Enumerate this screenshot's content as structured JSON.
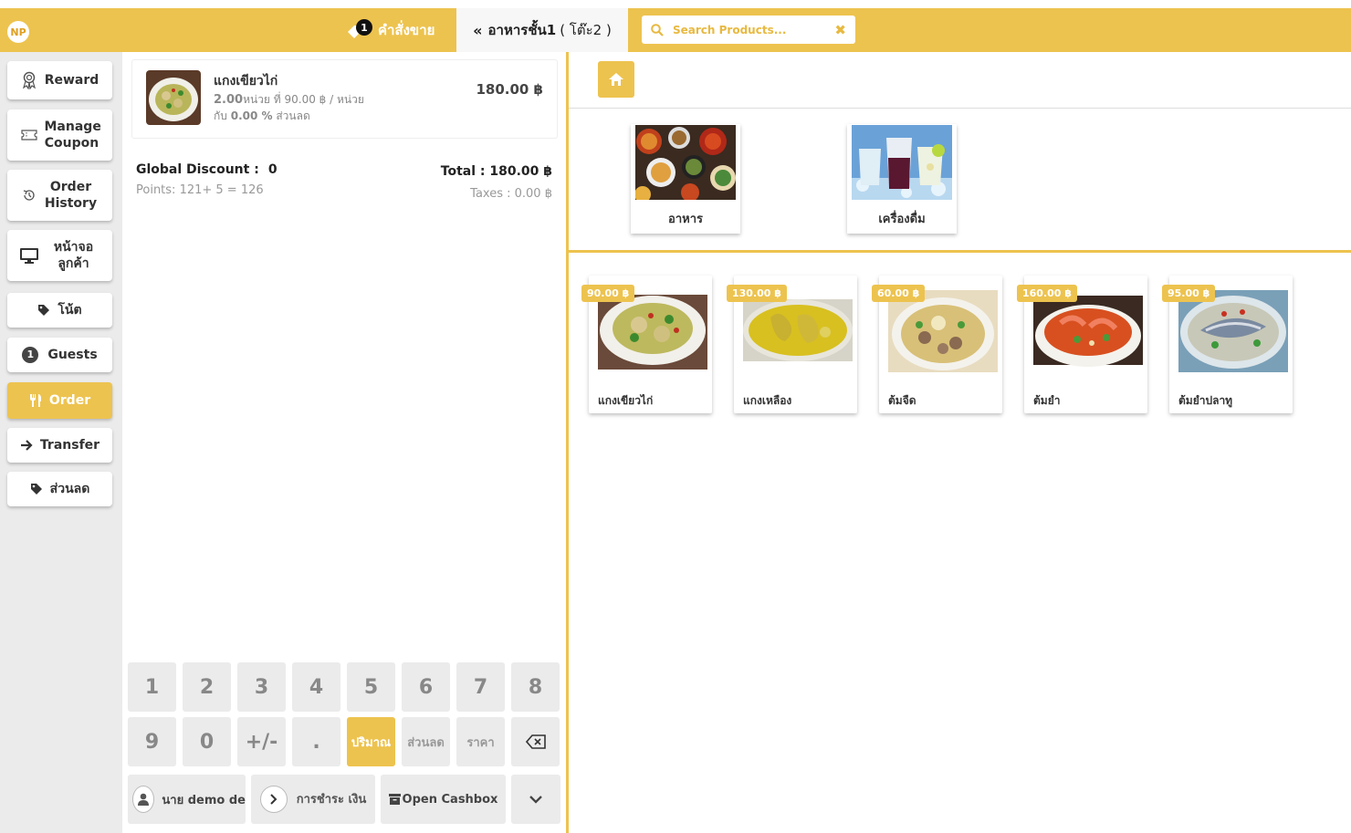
{
  "header": {
    "logo_text": "NP",
    "order_tab_label": "คำสั่งขาย",
    "order_count": "1",
    "table_tab_prefix": "อาหารชั้น1",
    "table_tab_suffix": "( โต๊ะ2 )",
    "search_placeholder": "Search Products..."
  },
  "sidebar": {
    "reward": "Reward",
    "manage_coupon": "Manage Coupon",
    "order_history": "Order History",
    "customer_screen": "หน้าจอ ลูกค้า",
    "note": "โน้ต",
    "guests_count": "1",
    "guests": "Guests",
    "order": "Order",
    "transfer": "Transfer",
    "discount": "ส่วนลด"
  },
  "order": {
    "line": {
      "name": "แกงเขียวไก่",
      "qty": "2.00",
      "qty_text": "หน่วย ที่ 90.00 ฿ / หน่วย",
      "disc_prefix": "กับ",
      "disc_value": "0.00 %",
      "disc_suffix": "ส่วนลด",
      "price": "180.00 ฿"
    },
    "global_discount_label": "Global Discount :",
    "global_discount_value": "0",
    "points": "Points: 121+ 5 = 126",
    "total": "Total : 180.00 ฿",
    "taxes": "Taxes : 0.00 ฿"
  },
  "keypad": {
    "row1": [
      "1",
      "2",
      "3",
      "4",
      "5",
      "6",
      "7",
      "8"
    ],
    "row2": [
      "9",
      "0",
      "+/-",
      "."
    ],
    "qty": "ปริมาณ",
    "discount": "ส่วนลด",
    "price": "ราคา"
  },
  "bottom": {
    "customer": "นาย demo de",
    "payment": "การชำระ เงิน",
    "cashbox": "Open Cashbox"
  },
  "categories": [
    {
      "label": "อาหาร"
    },
    {
      "label": "เครื่องดื่ม"
    }
  ],
  "products": [
    {
      "name": "แกงเขียวไก่",
      "price": "90.00 ฿"
    },
    {
      "name": "แกงเหลือง",
      "price": "130.00 ฿"
    },
    {
      "name": "ต้มจืด",
      "price": "60.00 ฿"
    },
    {
      "name": "ต้มยำ",
      "price": "160.00 ฿"
    },
    {
      "name": "ต้มยำปลาทู",
      "price": "95.00 ฿"
    }
  ],
  "colors": {
    "accent": "#edc34f",
    "sidebar_bg": "#ebebeb"
  }
}
